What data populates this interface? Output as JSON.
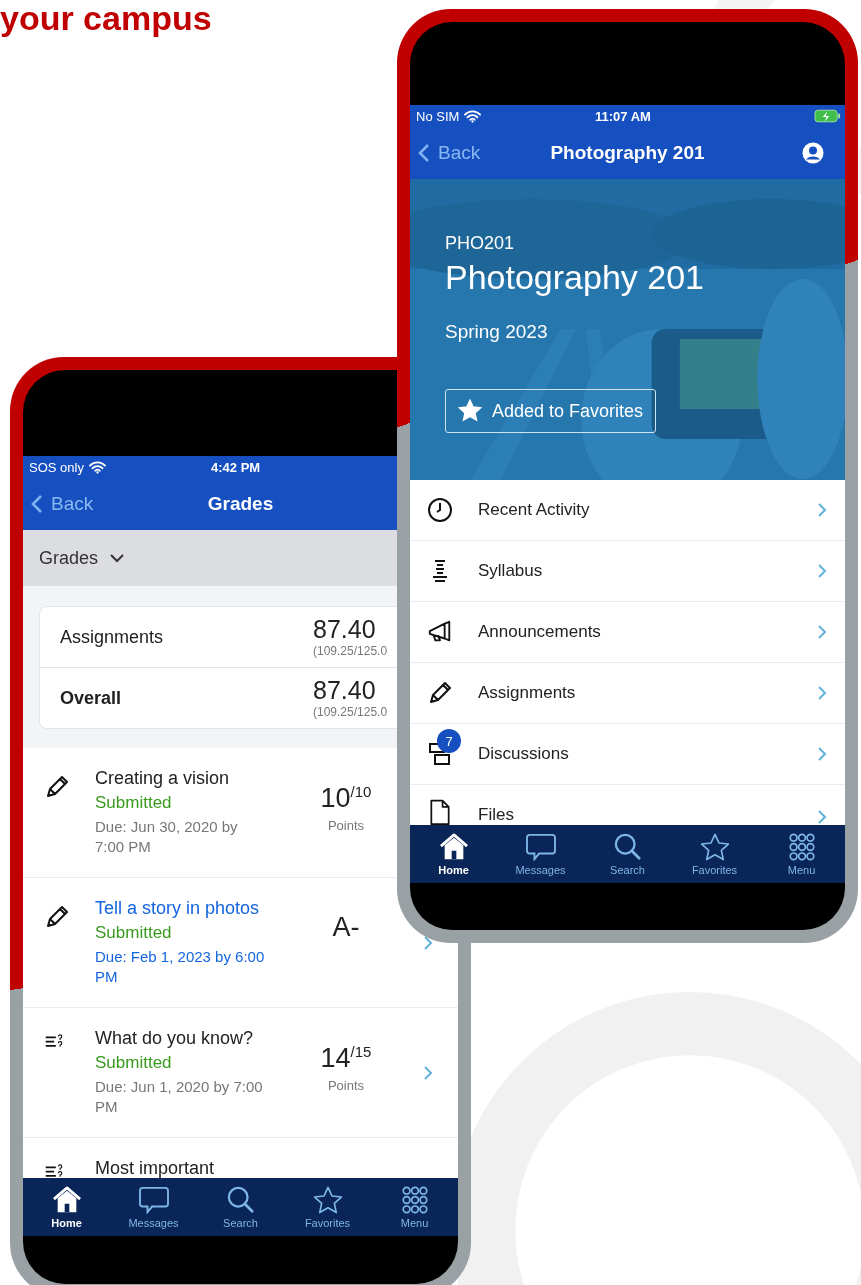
{
  "headline": "your campus",
  "grades_phone": {
    "status_bar": {
      "carrier": "SOS only",
      "time": "4:42 PM"
    },
    "nav": {
      "back": "Back",
      "title": "Grades"
    },
    "filter": {
      "label": "Grades"
    },
    "summary": [
      {
        "label": "Assignments",
        "bold": false,
        "value": "87.40",
        "detail": "(109.25/125.0"
      },
      {
        "label": "Overall",
        "bold": true,
        "value": "87.40",
        "detail": "(109.25/125.0"
      }
    ],
    "assignments": [
      {
        "kind": "assignment",
        "title": "Creating a vision",
        "highlighted": false,
        "status": "Submitted",
        "due": "Due: Jun 30, 2020 by 7:00 PM",
        "score": "10",
        "out_of": "/10",
        "score_label": "Points"
      },
      {
        "kind": "assignment",
        "title": "Tell a story in photos",
        "highlighted": true,
        "status": "Submitted",
        "due": "Due: Feb 1, 2023 by 6:00 PM",
        "score": "A-",
        "chevron": true
      },
      {
        "kind": "quiz",
        "title": "What do you know?",
        "highlighted": false,
        "status": "Submitted",
        "due": "Due: Jun 1, 2020 by 7:00 PM",
        "score": "14",
        "out_of": "/15",
        "score_label": "Points",
        "chevron": true
      },
      {
        "kind": "quiz",
        "title": "Most important",
        "highlighted": false
      }
    ],
    "tab_bar": [
      {
        "kind": "home",
        "label": "Home",
        "selected": true
      },
      {
        "kind": "messages",
        "label": "Messages",
        "selected": false
      },
      {
        "kind": "search",
        "label": "Search",
        "selected": false
      },
      {
        "kind": "favorites",
        "label": "Favorites",
        "selected": false
      },
      {
        "kind": "menu",
        "label": "Menu",
        "selected": false
      }
    ]
  },
  "course_phone": {
    "status_bar": {
      "carrier": "No SIM",
      "time": "11:07 AM"
    },
    "nav": {
      "back": "Back",
      "title": "Photography 201"
    },
    "hero": {
      "kind": "picture",
      "code": "PHO201",
      "title": "Photography 201",
      "term": "Spring 2023",
      "favorite": {
        "label": "Added to Favorites",
        "on": true
      }
    },
    "menu": [
      {
        "kind": "activity",
        "label": "Recent Activity"
      },
      {
        "kind": "syllabus",
        "label": "Syllabus"
      },
      {
        "kind": "announcements",
        "label": "Announcements"
      },
      {
        "kind": "assignments",
        "label": "Assignments"
      },
      {
        "kind": "discussions",
        "label": "Discussions",
        "badge": "7"
      },
      {
        "kind": "files",
        "label": "Files"
      }
    ],
    "tab_bar": [
      {
        "kind": "home",
        "label": "Home",
        "selected": true
      },
      {
        "kind": "messages",
        "label": "Messages",
        "selected": false
      },
      {
        "kind": "search",
        "label": "Search",
        "selected": false
      },
      {
        "kind": "favorites",
        "label": "Favorites",
        "selected": false
      },
      {
        "kind": "menu",
        "label": "Menu",
        "selected": false
      }
    ]
  }
}
